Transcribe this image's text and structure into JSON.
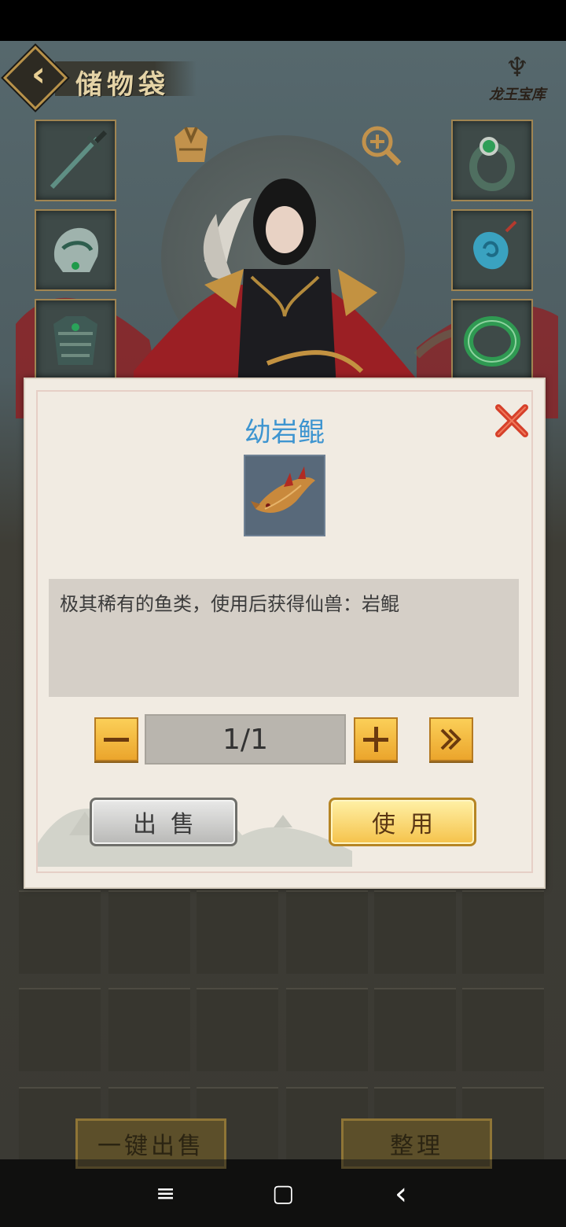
{
  "header": {
    "title": "储物袋",
    "logo_text": "龙王宝库"
  },
  "equipment": {
    "left": [
      "sword-icon",
      "helmet-icon",
      "armor-icon"
    ],
    "right": [
      "ring-icon",
      "jade-pendant-icon",
      "bracelet-icon"
    ]
  },
  "modal": {
    "item_name": "幼岩鲲",
    "description": "极其稀有的鱼类，使用后获得仙兽：岩鲲",
    "quantity": "1/1",
    "sell_label": "出售",
    "use_label": "使用"
  },
  "bottom": {
    "sell_all_label": "一键出售",
    "sort_label": "整理"
  },
  "navbar": {
    "menu_icon": "≡",
    "home_icon": "▢",
    "back_icon": "‹"
  },
  "colors": {
    "title_blue": "#3e95d0",
    "gold_button": "#f5c24a",
    "close_red": "#d6402a"
  }
}
